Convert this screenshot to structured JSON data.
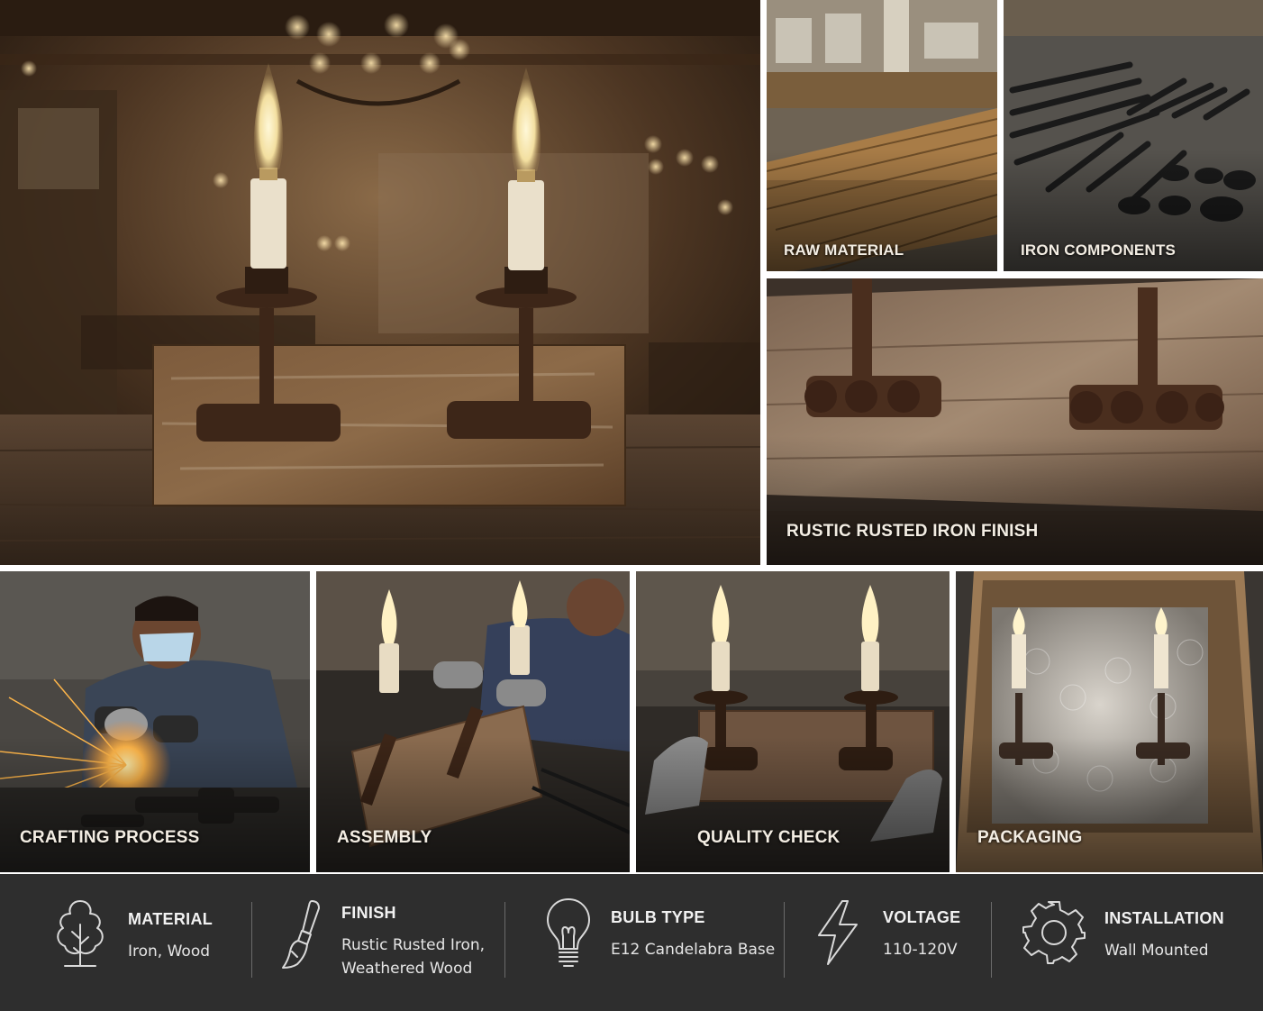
{
  "tiles": {
    "hero": {
      "icon": "wall-sconce-photo"
    },
    "raw_material": {
      "caption": "RAW MATERIAL"
    },
    "iron_components": {
      "caption": "IRON COMPONENTS"
    },
    "finish_detail": {
      "caption": "RUSTIC RUSTED IRON FINISH"
    },
    "crafting": {
      "caption": "CRAFTING PROCESS"
    },
    "assembly": {
      "caption": "ASSEMBLY"
    },
    "quality": {
      "caption": "QUALITY CHECK"
    },
    "packaging": {
      "caption": "PACKAGING"
    }
  },
  "specs": [
    {
      "icon": "tree-icon",
      "label": "MATERIAL",
      "value_lines": [
        "Iron, Wood"
      ]
    },
    {
      "icon": "paintbrush-icon",
      "label": "FINISH",
      "value_lines": [
        "Rustic Rusted Iron,",
        "Weathered Wood"
      ]
    },
    {
      "icon": "lightbulb-icon",
      "label": "BULB TYPE",
      "value_lines": [
        "E12 Candelabra Base"
      ]
    },
    {
      "icon": "lightning-bolt-icon",
      "label": "VOLTAGE",
      "value_lines": [
        "110-120V"
      ]
    },
    {
      "icon": "gear-icon",
      "label": "INSTALLATION",
      "value_lines": [
        "Wall Mounted"
      ]
    }
  ],
  "colors": {
    "spec_bar": "#2e2e2e",
    "caption_text": "#f3ede3",
    "wood": "#6a4a2e",
    "rust": "#4a2e1e"
  }
}
